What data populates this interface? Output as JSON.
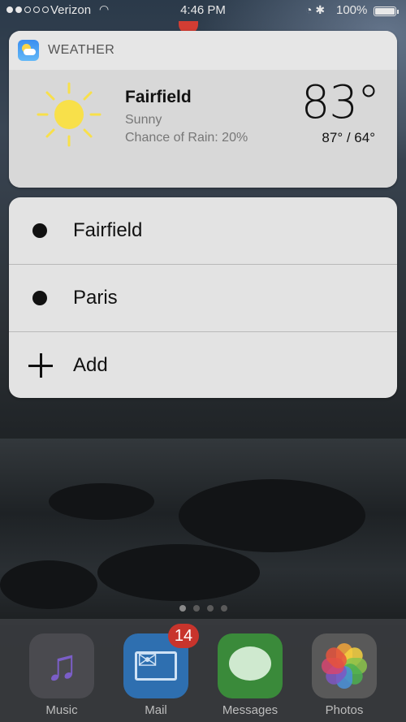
{
  "status_bar": {
    "carrier": "Verizon",
    "time": "4:46 PM",
    "battery": "100%"
  },
  "widget": {
    "app_name": "WEATHER",
    "city": "Fairfield",
    "condition": "Sunny",
    "rain": "Chance of Rain: 20%",
    "temperature": "83°",
    "high_low": "87° / 64°"
  },
  "menu": {
    "items": [
      {
        "label": "Fairfield",
        "icon": "bullet-icon"
      },
      {
        "label": "Paris",
        "icon": "bullet-icon"
      },
      {
        "label": "Add",
        "icon": "plus-icon"
      }
    ]
  },
  "dock": {
    "apps": [
      {
        "label": "Music"
      },
      {
        "label": "Mail",
        "badge": "14"
      },
      {
        "label": "Messages"
      },
      {
        "label": "Photos"
      }
    ]
  },
  "colors": {
    "sun": "#f8e04a",
    "badge": "#c8342c"
  }
}
